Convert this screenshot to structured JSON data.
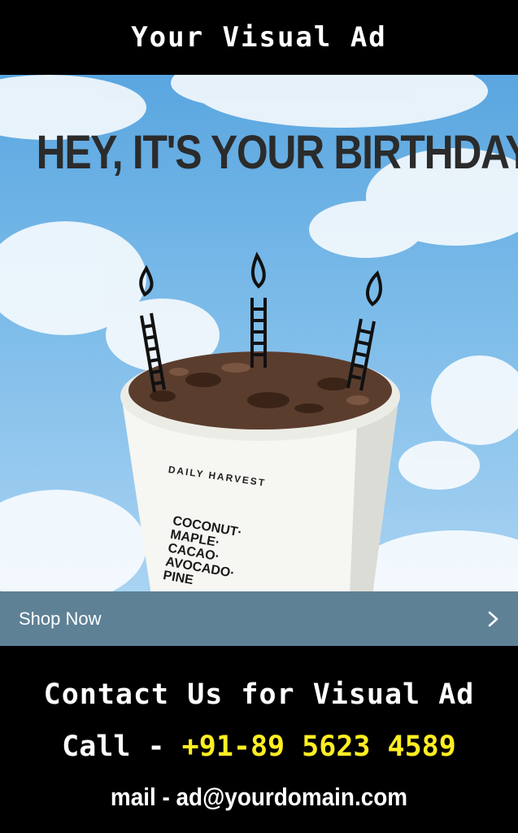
{
  "header": {
    "title": "Your Visual Ad"
  },
  "ad": {
    "headline": "HEY, IT'S YOUR BIRTHDAY!",
    "cup_brand": "DAILY HARVEST",
    "cup_flavors": [
      "COCONUT·",
      "MAPLE·",
      "CACAO·",
      "AVOCADO·",
      "PINE"
    ]
  },
  "cta": {
    "label": "Shop Now",
    "icon": "chevron-right-icon"
  },
  "contact": {
    "title": "Contact Us for Visual Ad",
    "call_label": "Call - ",
    "call_number": "+91-89 5623 4589",
    "mail": "mail - ad@yourdomain.com"
  },
  "colors": {
    "sky": "#7bbbe9",
    "cta_bar": "#5e8196",
    "phone_highlight": "#ffee22",
    "background": "#000000"
  }
}
